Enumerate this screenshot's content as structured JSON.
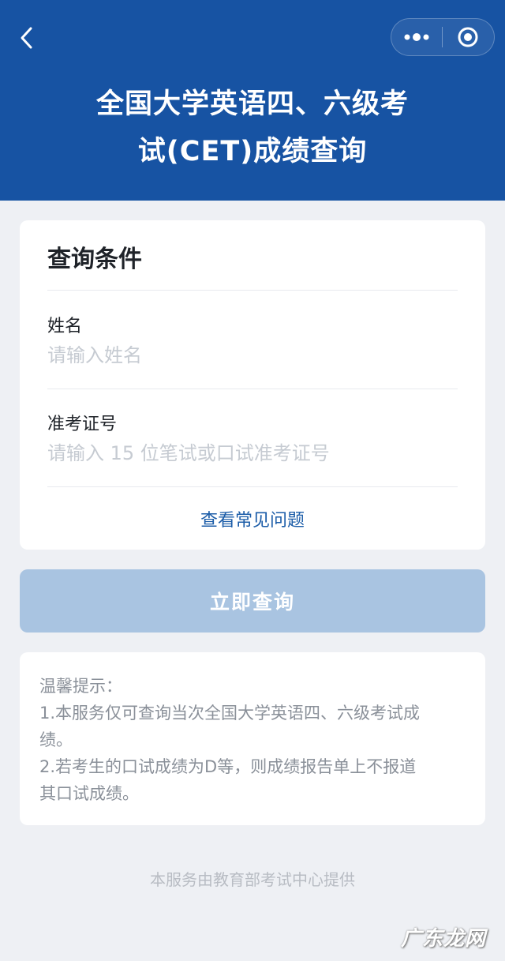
{
  "header": {
    "title_line1": "全国大学英语四、六级考",
    "title_line2": "试(CET)成绩查询",
    "back_icon": "chevron-left-icon",
    "more_icon": "more-dots-icon",
    "close_icon": "target-circle-icon"
  },
  "form": {
    "section_title": "查询条件",
    "name_label": "姓名",
    "name_placeholder": "请输入姓名",
    "ticket_label": "准考证号",
    "ticket_placeholder": "请输入 15 位笔试或口试准考证号",
    "faq_link": "查看常见问题"
  },
  "submit_label": "立即查询",
  "tips": {
    "title": "温馨提示：",
    "line1": "1.本服务仅可查询当次全国大学英语四、六级考试成",
    "line2": "绩。",
    "line3": "2.若考生的口试成绩为D等，则成绩报告单上不报道",
    "line4": "其口试成绩。"
  },
  "footer": "本服务由教育部考试中心提供",
  "watermark": "广东龙网",
  "colors": {
    "header_bg": "#1753a3",
    "button_bg": "#a9c4e1",
    "link": "#1b5ca8",
    "page_bg": "#eef0f4"
  }
}
